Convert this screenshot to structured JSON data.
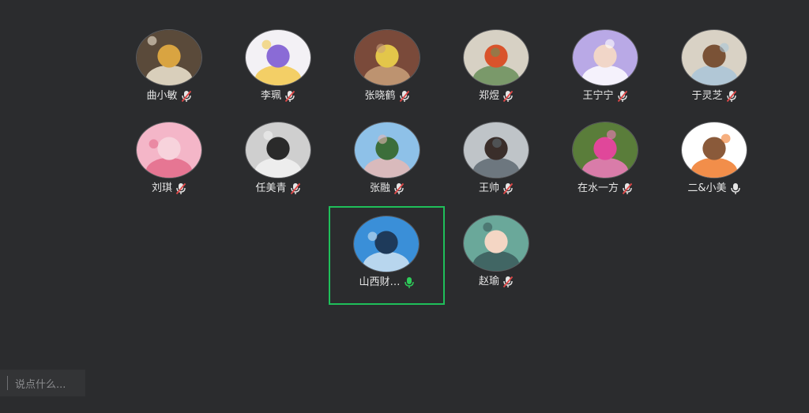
{
  "participants": [
    {
      "name": "曲小敏",
      "mic": "muted",
      "avatar": {
        "bg": "#5a4a3a",
        "fg": "#d9a441",
        "accent": "#f0e6d2"
      }
    },
    {
      "name": "李珮",
      "mic": "muted",
      "avatar": {
        "bg": "#f3f1f5",
        "fg": "#8a6bd6",
        "accent": "#f2c94c"
      }
    },
    {
      "name": "张晓鹤",
      "mic": "muted",
      "avatar": {
        "bg": "#7a4a3a",
        "fg": "#e3c64a",
        "accent": "#c9a07a"
      }
    },
    {
      "name": "郑煜",
      "mic": "muted",
      "avatar": {
        "bg": "#d7d1c4",
        "fg": "#d9532b",
        "accent": "#6a8f5a"
      }
    },
    {
      "name": "王宁宁",
      "mic": "muted",
      "avatar": {
        "bg": "#b9a9e6",
        "fg": "#f1d6c8",
        "accent": "#ffffff"
      }
    },
    {
      "name": "于灵芝",
      "mic": "muted",
      "avatar": {
        "bg": "#d9d2c5",
        "fg": "#7a5236",
        "accent": "#a9c6d8"
      }
    },
    {
      "name": "刘琪",
      "mic": "muted",
      "avatar": {
        "bg": "#f4b6c8",
        "fg": "#f7d3dc",
        "accent": "#e36b8a"
      }
    },
    {
      "name": "任美青",
      "mic": "muted",
      "avatar": {
        "bg": "#cfcfcf",
        "fg": "#2a2a2a",
        "accent": "#f2f2f2"
      }
    },
    {
      "name": "张融",
      "mic": "muted",
      "avatar": {
        "bg": "#8ec1e8",
        "fg": "#3c6e3a",
        "accent": "#e6b8b4"
      }
    },
    {
      "name": "王帅",
      "mic": "muted",
      "avatar": {
        "bg": "#bfc4c8",
        "fg": "#3a2e2a",
        "accent": "#5e6a72"
      }
    },
    {
      "name": "在水一方",
      "mic": "muted",
      "avatar": {
        "bg": "#5a7d3a",
        "fg": "#e0479a",
        "accent": "#f07bbd"
      }
    },
    {
      "name": "二&小美",
      "mic": "on",
      "avatar": {
        "bg": "#ffffff",
        "fg": "#8a5a3a",
        "accent": "#f07a2a"
      }
    },
    {
      "name": "山西财…",
      "mic": "active",
      "active": true,
      "avatar": {
        "bg": "#3a8fd8",
        "fg": "#1e3a5a",
        "accent": "#cfe3f2"
      }
    },
    {
      "name": "赵瑜",
      "mic": "muted",
      "avatar": {
        "bg": "#6aa89a",
        "fg": "#f4d6c4",
        "accent": "#3a5a5a"
      }
    }
  ],
  "chat": {
    "placeholder": "说点什么..."
  },
  "colors": {
    "background": "#2b2c2e",
    "active_border": "#1fbf5a",
    "mic_active": "#2ecc5a",
    "mic_muted_slash": "#e04848",
    "text": "#e6e6e6"
  }
}
